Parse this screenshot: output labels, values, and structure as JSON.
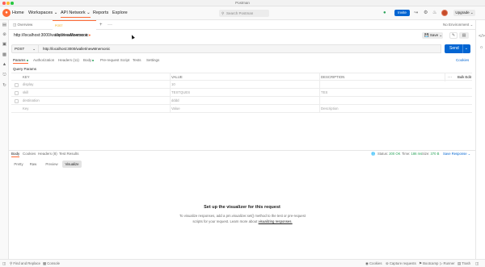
{
  "window": {
    "title": "Postman"
  },
  "nav": {
    "home": "Home",
    "workspaces": "Workspaces",
    "api_network": "API Network",
    "reports": "Reports",
    "explore": "Explore"
  },
  "search": {
    "placeholder": "Search Postman"
  },
  "header": {
    "invite": "Invite",
    "upgrade": "Upgrade"
  },
  "tabs": {
    "overview": "Overview",
    "request_tab": "http://localhost:3000",
    "add": "+",
    "more": "···"
  },
  "environment": {
    "label": "No Environment"
  },
  "request": {
    "title": "http://localhost:3000/wallet/newMnemonic",
    "save": "Save",
    "method": "POST",
    "url": "http://localhost:3000/wallet/newMnemonic",
    "send": "Send"
  },
  "request_tabs": {
    "params": "Params",
    "authorization": "Authorization",
    "headers": "Headers (11)",
    "body": "Body",
    "prerequest": "Pre-request Script",
    "tests": "Tests",
    "settings": "Settings",
    "cookies": "Cookies"
  },
  "params": {
    "section_title": "Query Params",
    "headers": {
      "key": "KEY",
      "value": "VALUE",
      "description": "DESCRIPTION",
      "bulk_edit": "Bulk Edit"
    },
    "rows": [
      {
        "key": "display",
        "value": "10",
        "description": ""
      },
      {
        "key": "skill",
        "value": "TESTQUES",
        "description": "TES"
      },
      {
        "key": "destination",
        "value": "dddd",
        "description": ""
      },
      {
        "key": "Key",
        "value": "Value",
        "description": "Description"
      }
    ]
  },
  "response": {
    "tabs": {
      "body": "Body",
      "cookies": "Cookies",
      "headers": "Headers (8)",
      "test_results": "Test Results"
    },
    "status_label": "Status:",
    "status_value": "200 OK",
    "time_label": "Time:",
    "time_value": "186 ms",
    "size_label": "Size:",
    "size_value": "370 B",
    "save_response": "Save Response",
    "modes": [
      "Pretty",
      "Raw",
      "Preview",
      "Visualize"
    ],
    "visualizer_heading": "Set up the visualizer for this request",
    "visualizer_line1": "To visualize responses, add a pm.visualizer.set() method to the test or pre-request",
    "visualizer_line2": "scripts for your request. Learn more about",
    "visualizer_link": "visualizing responses."
  },
  "statusbar": {
    "find_replace": "Find and Replace",
    "console": "Console",
    "cookies": "Cookies",
    "capture": "Capture requests",
    "bootcamp": "Bootcamp",
    "runner": "Runner",
    "trash": "Trash"
  },
  "colors": {
    "brand": "#ff6c37",
    "primary": "#0265d2",
    "success": "#29a35a"
  }
}
